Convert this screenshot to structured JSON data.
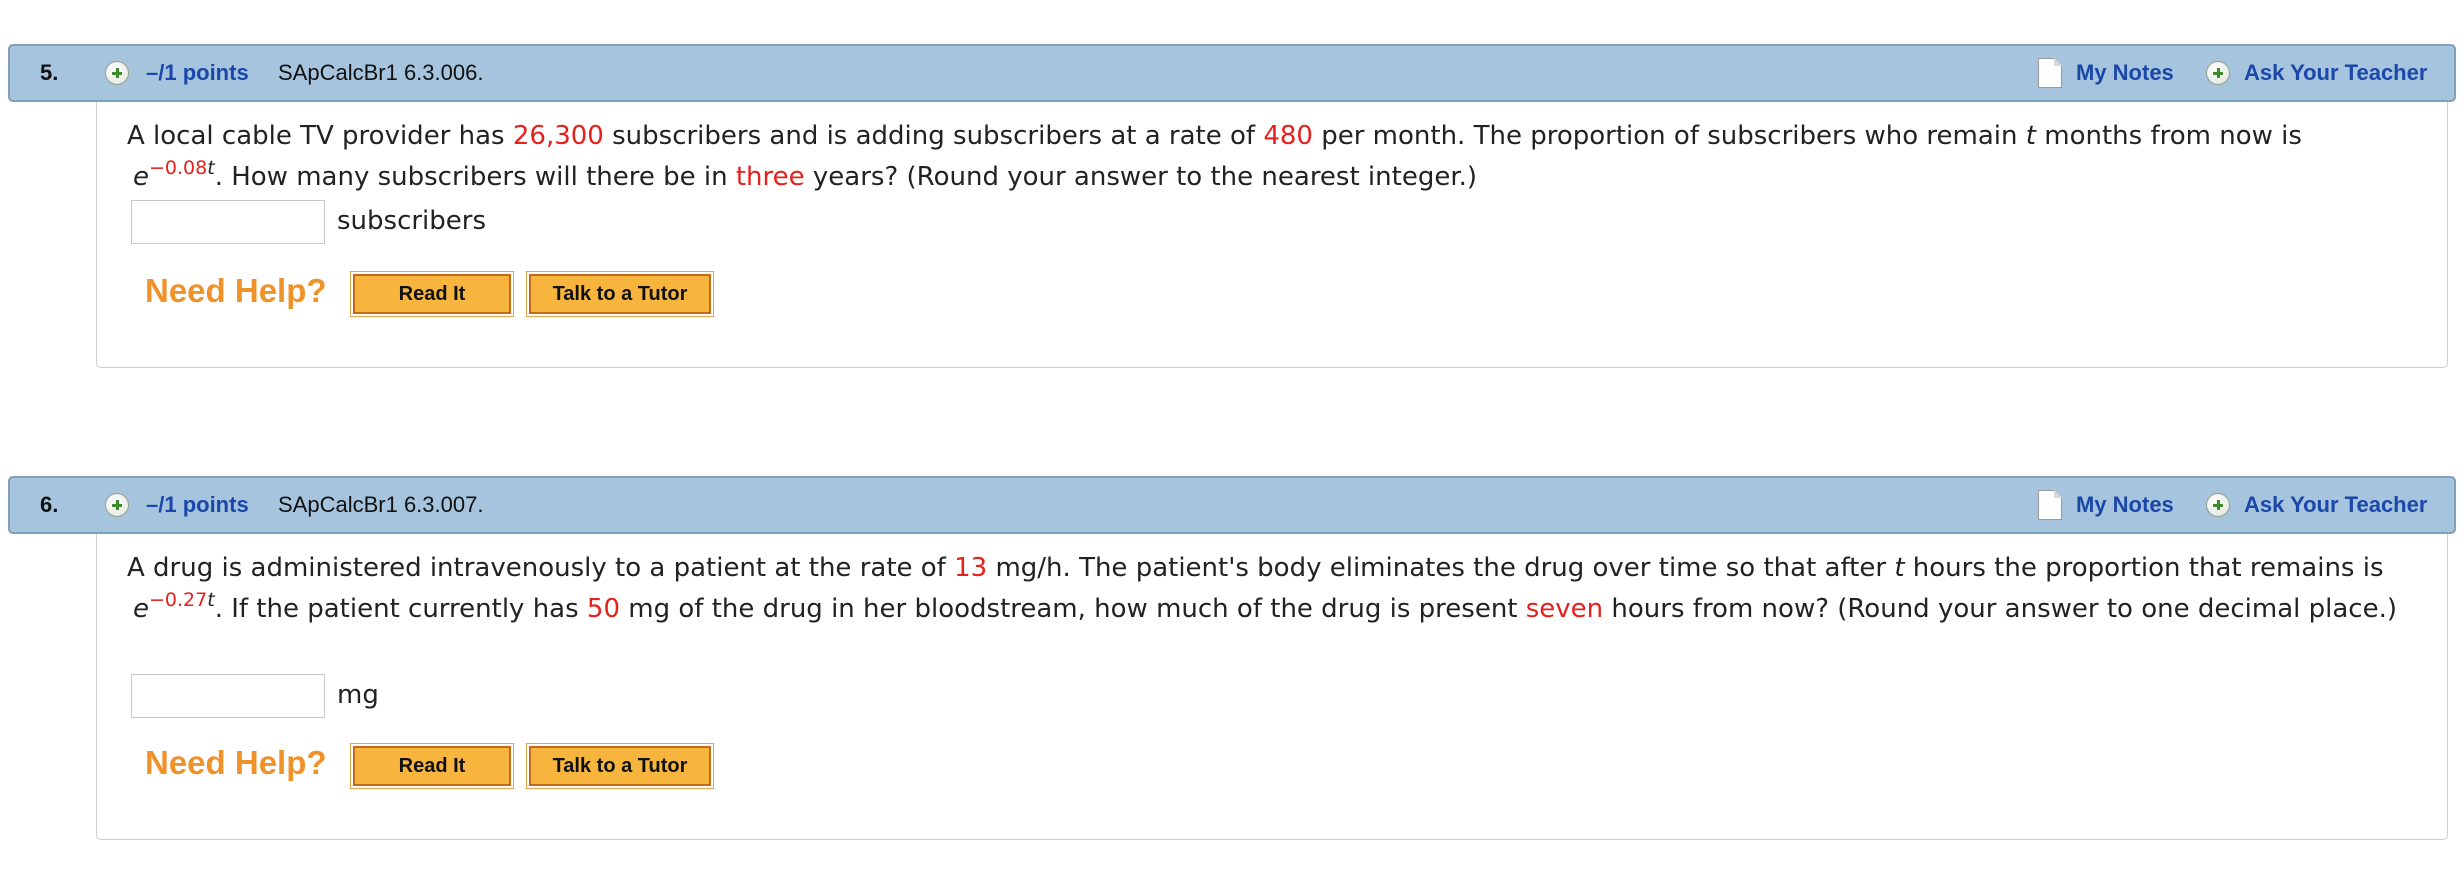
{
  "questions": [
    {
      "number": "5.",
      "points": "–/1 points",
      "code": "SApCalcBr1 6.3.006.",
      "my_notes": "My Notes",
      "ask_teacher": "Ask Your Teacher",
      "text": {
        "p1": "A local cable TV provider has ",
        "v1": "26,300",
        "p2": " subscribers and is adding subscribers at a rate of ",
        "v2": "480",
        "p3": " per month. The proportion of subscribers who remain ",
        "var1": "t",
        "p4": " months from now is ",
        "base": "e",
        "exp_coef": "−0.08",
        "exp_var": "t",
        "p5": ".  How many subscribers will there be in ",
        "v3": "three",
        "p6": " years? (Round your answer to the nearest integer.)"
      },
      "answer_value": "",
      "unit": "subscribers",
      "need_help": "Need Help?",
      "read_it": "Read It",
      "talk_tutor": "Talk to a Tutor"
    },
    {
      "number": "6.",
      "points": "–/1 points",
      "code": "SApCalcBr1 6.3.007.",
      "my_notes": "My Notes",
      "ask_teacher": "Ask Your Teacher",
      "text": {
        "p1": "A drug is administered intravenously to a patient at the rate of ",
        "v1": "13",
        "p2": " mg/h. The patient's body eliminates the drug over time so that after ",
        "var1": "t",
        "p3": " hours the proportion that remains is ",
        "base": "e",
        "exp_coef": "−0.27",
        "exp_var": "t",
        "p4": ".  If the patient currently has ",
        "v2": "50",
        "p5": " mg of the drug in her bloodstream, how much of the drug is present ",
        "v3": "seven",
        "p6": " hours from now? (Round your answer to one decimal place.)"
      },
      "answer_value": "",
      "unit": "mg",
      "need_help": "Need Help?",
      "read_it": "Read It",
      "talk_tutor": "Talk to a Tutor"
    }
  ]
}
